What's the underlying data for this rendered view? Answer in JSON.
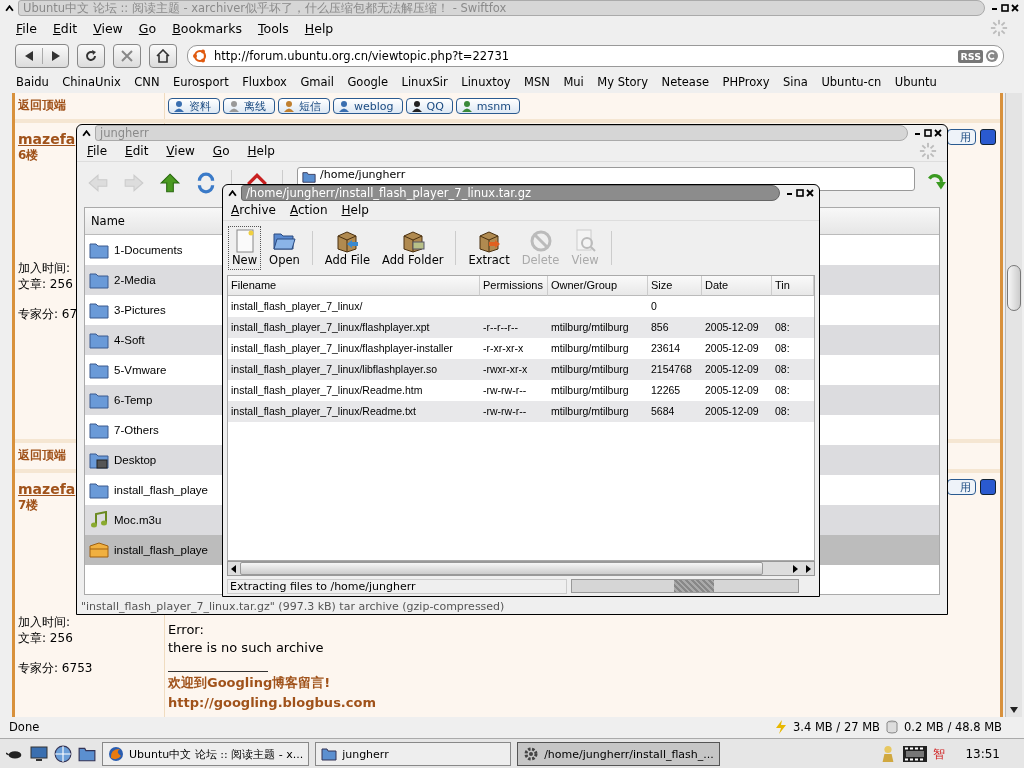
{
  "browser": {
    "title": "Ubuntu中文 论坛 :: 阅读主题 - xarchiver似乎坏了，什么压缩包都无法解压缩！ - Swiftfox",
    "menu": [
      "File",
      "Edit",
      "View",
      "Go",
      "Bookmarks",
      "Tools",
      "Help"
    ],
    "url": "http://forum.ubuntu.org.cn/viewtopic.php?t=22731",
    "rss": "RSS",
    "bookmarks": [
      "Baidu",
      "ChinaUnix",
      "CNN",
      "Eurosport",
      "Fluxbox",
      "Gmail",
      "Google",
      "LinuxSir",
      "Linuxtoy",
      "MSN",
      "Mui",
      "My Story",
      "Netease",
      "PHProxy",
      "Sina",
      "Ubuntu-cn",
      "Ubuntu"
    ],
    "status": "Done",
    "memory": [
      "3.4 MB / 27 MB",
      "0.2 MB / 48.8 MB"
    ]
  },
  "forum": {
    "blocks": [
      {
        "kind": "back_to_top",
        "label": "返回顶端",
        "buttons": [
          {
            "label": "资料",
            "kind": "profile"
          },
          {
            "label": "离线",
            "kind": "offline"
          },
          {
            "label": "短信",
            "kind": "message"
          },
          {
            "label": "weblog",
            "kind": "weblog"
          },
          {
            "label": "QQ",
            "kind": "qq"
          },
          {
            "label": "msnm",
            "kind": "msn"
          }
        ]
      },
      {
        "kind": "post",
        "author": "mazefa",
        "floor": "6楼",
        "info": [
          "加入时间:",
          "文章: 256",
          "专家分: 67"
        ],
        "side_button": "用"
      },
      {
        "kind": "back_to_top",
        "label": "返回顶端"
      },
      {
        "kind": "post",
        "author": "mazefa",
        "floor": "7楼",
        "info": [
          "加入时间:",
          "文章: 256",
          "专家分: 6753"
        ],
        "side_button": "用",
        "body": [
          "Error:",
          "there is no such archive"
        ],
        "signature": [
          "欢迎到Googling博客留言!",
          "http://googling.blogbus.com"
        ]
      }
    ]
  },
  "file_manager": {
    "title": "jungherr",
    "menu": [
      "File",
      "Edit",
      "View",
      "Go",
      "Help"
    ],
    "location": "/home/jungherr",
    "list_header": "Name",
    "items": [
      {
        "name": "1-Documents",
        "kind": "folder",
        "selected": false
      },
      {
        "name": "2-Media",
        "kind": "folder",
        "selected": false
      },
      {
        "name": "3-Pictures",
        "kind": "folder",
        "selected": false
      },
      {
        "name": "4-Soft",
        "kind": "folder",
        "selected": false
      },
      {
        "name": "5-Vmware",
        "kind": "folder",
        "selected": false
      },
      {
        "name": "6-Temp",
        "kind": "folder",
        "selected": false
      },
      {
        "name": "7-Others",
        "kind": "folder",
        "selected": false
      },
      {
        "name": "Desktop",
        "kind": "desktop",
        "selected": false
      },
      {
        "name": "install_flash_playe",
        "kind": "folder",
        "selected": false
      },
      {
        "name": "Moc.m3u",
        "kind": "audio",
        "selected": false
      },
      {
        "name": "install_flash_playe",
        "kind": "archive",
        "selected": true
      }
    ],
    "status": "\"install_flash_player_7_linux.tar.gz\" (997.3 kB) tar archive (gzip-compressed)"
  },
  "archiver": {
    "title": "/home/jungherr/install_flash_player_7_linux.tar.gz",
    "menu": [
      "Archive",
      "Action",
      "Help"
    ],
    "tools": [
      {
        "label": "New",
        "kind": "new",
        "disabled": false,
        "focused": true
      },
      {
        "label": "Open",
        "kind": "open",
        "disabled": false,
        "focused": false
      },
      {
        "label": "Add File",
        "kind": "add_file",
        "disabled": false,
        "focused": false
      },
      {
        "label": "Add Folder",
        "kind": "add_folder",
        "disabled": false,
        "focused": false
      },
      {
        "label": "Extract",
        "kind": "extract",
        "disabled": false,
        "focused": false
      },
      {
        "label": "Delete",
        "kind": "delete",
        "disabled": true,
        "focused": false
      },
      {
        "label": "View",
        "kind": "view",
        "disabled": true,
        "focused": false
      }
    ],
    "columns": [
      "Filename",
      "Permissions",
      "Owner/Group",
      "Size",
      "Date",
      "Tin"
    ],
    "rows": [
      {
        "filename": "install_flash_player_7_linux/",
        "size": "0"
      },
      {
        "filename": "install_flash_player_7_linux/flashplayer.xpt",
        "permissions": "-r--r--r--",
        "owner": "mtilburg/mtilburg",
        "size": "856",
        "date": "2005-12-09",
        "column_6": "08:"
      },
      {
        "filename": "install_flash_player_7_linux/flashplayer-installer",
        "permissions": "-r-xr-xr-x",
        "owner": "mtilburg/mtilburg",
        "size": "23614",
        "date": "2005-12-09",
        "column_6": "08:"
      },
      {
        "filename": "install_flash_player_7_linux/libflashplayer.so",
        "permissions": "-rwxr-xr-x",
        "owner": "mtilburg/mtilburg",
        "size": "2154768",
        "date": "2005-12-09",
        "column_6": "08:"
      },
      {
        "filename": "install_flash_player_7_linux/Readme.htm",
        "permissions": "-rw-rw-r--",
        "owner": "mtilburg/mtilburg",
        "size": "12265",
        "date": "2005-12-09",
        "column_6": "08:"
      },
      {
        "filename": "install_flash_player_7_linux/Readme.txt",
        "permissions": "-rw-rw-r--",
        "owner": "mtilburg/mtilburg",
        "size": "5684",
        "date": "2005-12-09",
        "column_6": "08:"
      }
    ],
    "status": "Extracting files to /home/jungherr",
    "busy": true
  },
  "taskbar": {
    "tasks": [
      {
        "label": "Ubuntu中文 论坛 :: 阅读主题 - x...",
        "kind": "browser",
        "selected": false
      },
      {
        "label": "jungherr",
        "kind": "folder",
        "selected": false
      },
      {
        "label": "/home/jungherr/install_flash_...",
        "kind": "gear",
        "selected": true
      }
    ],
    "tray_char": "智",
    "clock": "13:51"
  }
}
